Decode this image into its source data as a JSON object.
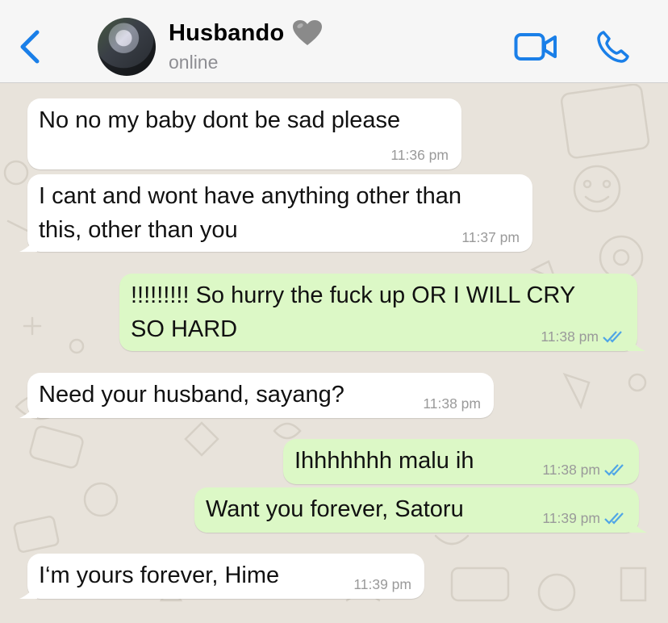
{
  "header": {
    "contact_name": "Husbando",
    "status": "online"
  },
  "colors": {
    "accent": "#1a7fe8",
    "incoming_bubble": "#ffffff",
    "outgoing_bubble": "#dcf8c6",
    "wallpaper": "#e8e3db",
    "read_ticks": "#4fa5e6"
  },
  "icons": {
    "back": "chevron-left-icon",
    "heart": "grey-heart-emoji",
    "video": "video-camera-icon",
    "phone": "phone-icon",
    "ticks": "double-check-icon"
  },
  "messages": [
    {
      "direction": "incoming",
      "text": "No no my baby dont be sad please",
      "time": "11:36 pm"
    },
    {
      "direction": "incoming",
      "text_lines": [
        "I cant and wont have anything other than",
        "this, other than you"
      ],
      "time": "11:37 pm"
    },
    {
      "direction": "outgoing",
      "text_lines": [
        "!!!!!!!!! So hurry the fuck up OR I WILL CRY",
        "SO HARD"
      ],
      "time": "11:38 pm",
      "read": true
    },
    {
      "direction": "incoming",
      "text": "Need your husband, sayang?",
      "time": "11:38 pm"
    },
    {
      "direction": "outgoing",
      "text": "Ihhhhhhh malu ih",
      "time": "11:38 pm",
      "read": true
    },
    {
      "direction": "outgoing",
      "text": "Want you forever, Satoru",
      "time": "11:39 pm",
      "read": true
    },
    {
      "direction": "incoming",
      "text": "I‘m yours forever, Hime",
      "time": "11:39 pm"
    }
  ]
}
